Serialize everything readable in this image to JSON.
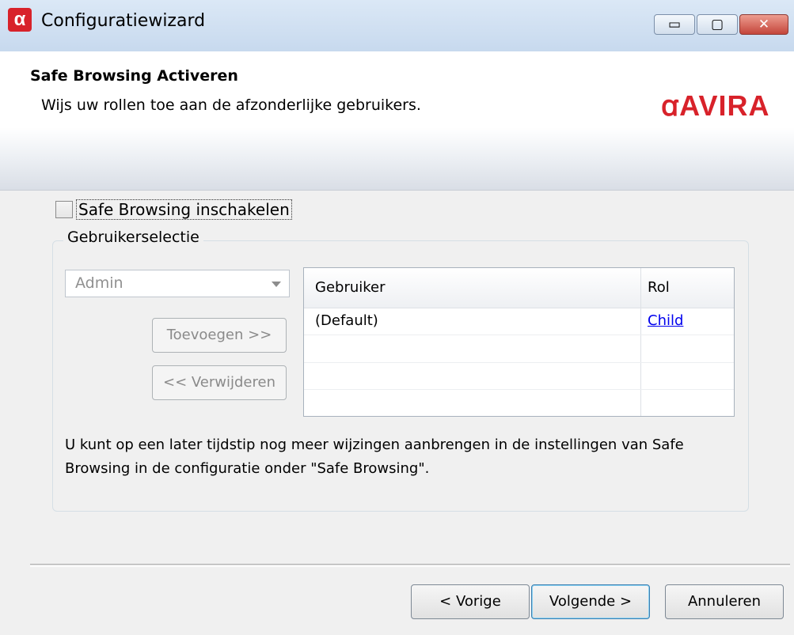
{
  "window": {
    "title": "Configuratiewizard",
    "logo_letter": "α",
    "controls": {
      "minimize": "▭",
      "maximize": "▢",
      "close": "✕"
    }
  },
  "header": {
    "title": "Safe Browsing Activeren",
    "subtitle": "Wijs uw rollen toe aan de afzonderlijke gebruikers.",
    "brand": "ꭤAVIRA"
  },
  "checkbox": {
    "label": "Safe Browsing inschakelen",
    "checked": false
  },
  "group": {
    "title": "Gebruikerselectie",
    "select_value": "Admin",
    "add_label": "Toevoegen >>",
    "remove_label": "<< Verwijderen"
  },
  "table": {
    "headers": [
      "Gebruiker",
      "Rol"
    ],
    "rows": [
      {
        "user": "(Default)",
        "role": "Child"
      }
    ]
  },
  "note": "U kunt op een later tijdstip nog meer wijzingen aanbrengen in de instellingen van Safe Browsing in de configuratie onder \"Safe Browsing\".",
  "buttons": {
    "prev": "< Vorige",
    "next": "Volgende >",
    "cancel": "Annuleren"
  }
}
